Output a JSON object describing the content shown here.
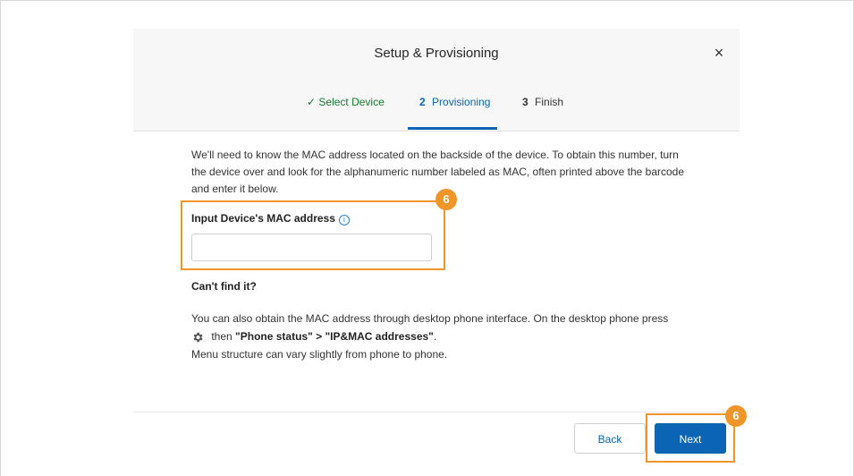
{
  "dialog": {
    "title": "Setup & Provisioning",
    "close_glyph": "×"
  },
  "steps": [
    {
      "label": "Select Device",
      "marker": "✓",
      "state": "done"
    },
    {
      "label": "Provisioning",
      "number": "2",
      "state": "active"
    },
    {
      "label": "Finish",
      "number": "3",
      "state": "pending"
    }
  ],
  "content": {
    "intro": "We'll need to know the MAC address located on the backside of the device. To obtain this number, turn the device over and look for the alphanumeric number labeled as MAC, often printed above the barcode and enter it below.",
    "mac_label": "Input Device's MAC address",
    "mac_info_glyph": "i",
    "mac_value": "",
    "cant_find": "Can't find it?",
    "help_line1": "You can also obtain the MAC address through desktop phone interface. On the desktop phone press",
    "help_then": "then",
    "help_path": "\"Phone status\" > \"IP&MAC addresses\"",
    "help_end": ".",
    "help_line3": "Menu structure can vary slightly from phone to phone."
  },
  "annotations": {
    "callout_field": "6",
    "callout_next": "6",
    "highlight_color": "#f0952a"
  },
  "footer": {
    "back_label": "Back",
    "next_label": "Next"
  },
  "colors": {
    "accent": "#0b64b4",
    "success": "#147a2e",
    "header_bg": "#f7f7f7"
  }
}
